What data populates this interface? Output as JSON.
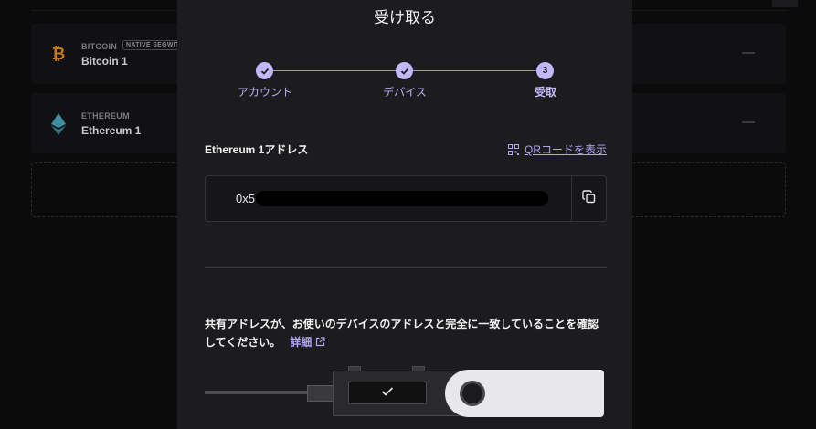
{
  "background": {
    "accounts": [
      {
        "ticker": "BITCOIN",
        "tag": "NATIVE SEGWIT",
        "name": "Bitcoin 1",
        "icon": "bitcoin-icon",
        "color": "#f7931a",
        "balance": "—"
      },
      {
        "ticker": "ETHEREUM",
        "tag": "",
        "name": "Ethereum 1",
        "icon": "ethereum-icon",
        "color": "#4fb0c6",
        "balance": "—"
      }
    ]
  },
  "modal": {
    "title": "受け取る",
    "steps": [
      {
        "label": "アカウント",
        "marker": "✓",
        "state": "done"
      },
      {
        "label": "デバイス",
        "marker": "✓",
        "state": "done"
      },
      {
        "label": "受取",
        "marker": "3",
        "state": "active"
      }
    ],
    "address_label": "Ethereum 1アドレス",
    "qr_link": "QRコードを表示",
    "address_value": "0x5",
    "verify_text": "共有アドレスが、お使いのデバイスのアドレスと完全に一致していることを確認してください。",
    "more_link": "詳細",
    "device_screen_icon": "check-icon"
  },
  "colors": {
    "accent": "#bbaff6",
    "modal_bg": "#1c1c1f",
    "page_bg": "#0b0b0c"
  }
}
